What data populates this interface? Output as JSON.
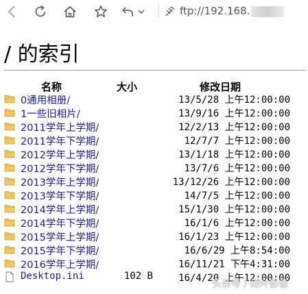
{
  "toolbar": {
    "back_icon": "back-icon",
    "refresh_icon": "refresh-icon",
    "home_icon": "home-icon",
    "favorite_icon": "star-icon",
    "undo_icon": "undo-icon",
    "address": "ftp://192.168.1"
  },
  "page": {
    "title": "/ 的索引"
  },
  "columns": {
    "name": "名称",
    "size": "大小",
    "date": "修改日期"
  },
  "rows": [
    {
      "type": "folder",
      "name": "0通用相册/",
      "size": "",
      "date": "13/5/28 上午12:00:00"
    },
    {
      "type": "folder",
      "name": "1一些旧相片/",
      "size": "",
      "date": "13/9/16 上午12:00:00"
    },
    {
      "type": "folder",
      "name": "2011学年上学期/",
      "size": "",
      "date": "12/2/13 上午12:00:00"
    },
    {
      "type": "folder",
      "name": "2011学年下学期/",
      "size": "",
      "date": "12/7/7 上午12:00:00"
    },
    {
      "type": "folder",
      "name": "2012学年上学期/",
      "size": "",
      "date": "13/1/18 上午12:00:00"
    },
    {
      "type": "folder",
      "name": "2012学年下学期/",
      "size": "",
      "date": "13/7/6 上午12:00:00"
    },
    {
      "type": "folder",
      "name": "2013学年上学期/",
      "size": "",
      "date": "13/12/26 上午12:00:00"
    },
    {
      "type": "folder",
      "name": "2013学年下学期/",
      "size": "",
      "date": "14/7/5 上午12:00:00"
    },
    {
      "type": "folder",
      "name": "2014学年上学期/",
      "size": "",
      "date": "15/1/30 上午12:00:00"
    },
    {
      "type": "folder",
      "name": "2014学年下学期/",
      "size": "",
      "date": "16/1/6 上午12:00:00"
    },
    {
      "type": "folder",
      "name": "2015学年上学期/",
      "size": "",
      "date": "16/1/23 上午12:00:00"
    },
    {
      "type": "folder",
      "name": "2015学年下学期/",
      "size": "",
      "date": "16/6/29 上午8:54:00"
    },
    {
      "type": "folder",
      "name": "2016学年上学期/",
      "size": "",
      "date": "16/11/21 下午4:31:00"
    },
    {
      "type": "file",
      "name": "Desktop.ini",
      "size": "102 B",
      "date": "16/4/20 上午12:00:00"
    }
  ],
  "watermark": "头条号 / 绿叶影像",
  "colors": {
    "link": "#1a1aa6",
    "folder": "#f2c75c",
    "rule": "#9a9a9a"
  }
}
